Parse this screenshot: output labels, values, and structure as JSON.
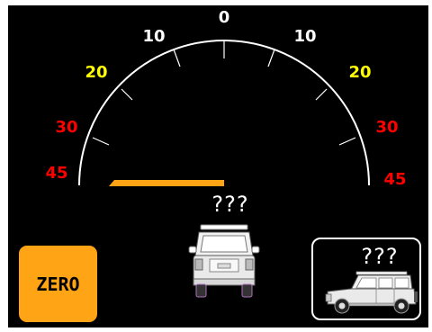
{
  "gauge": {
    "scale_labels": [
      {
        "text": "45",
        "color": "#ff0000",
        "side": "left"
      },
      {
        "text": "30",
        "color": "#ff0000",
        "side": "left"
      },
      {
        "text": "20",
        "color": "#ffff00",
        "side": "left"
      },
      {
        "text": "10",
        "color": "#ffffff",
        "side": "left"
      },
      {
        "text": "0",
        "color": "#ffffff",
        "side": "center"
      },
      {
        "text": "10",
        "color": "#ffffff",
        "side": "right"
      },
      {
        "text": "20",
        "color": "#ffff00",
        "side": "right"
      },
      {
        "text": "30",
        "color": "#ff0000",
        "side": "right"
      },
      {
        "text": "45",
        "color": "#ff0000",
        "side": "right"
      }
    ],
    "level_bar_color": "#ffa515",
    "level_bar_direction": "left"
  },
  "front_view": {
    "pitch_readout": "???",
    "icon": "suv-rear-icon"
  },
  "zero_button": {
    "label": "ZERO",
    "color": "#ffa515"
  },
  "side_view": {
    "roll_readout": "???",
    "icon": "suv-side-icon"
  },
  "colors": {
    "background": "#000000",
    "danger": "#ff0000",
    "warning": "#ffff00",
    "normal": "#ffffff"
  }
}
